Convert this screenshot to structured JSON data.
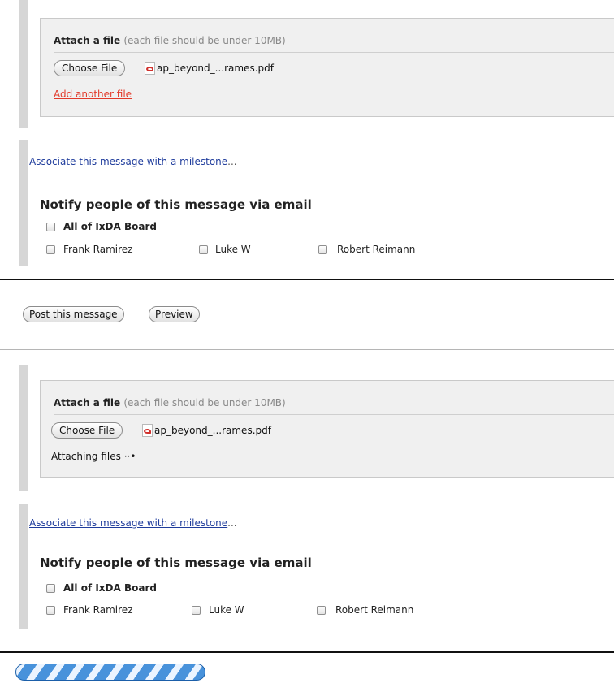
{
  "panels": [
    {
      "attach_title": "Attach a file",
      "attach_note": "(each file should be under 10MB)",
      "choose_file_label": "Choose File",
      "file_name": "ap_beyond_...rames.pdf",
      "add_another_label": "Add another file",
      "milestone_link": "Associate this message with a milestone",
      "milestone_ellipsis": "...",
      "notify_title": "Notify people of this message via email",
      "recipients": [
        "All of IxDA Board",
        "Frank Ramirez",
        "Luke W",
        "Robert Reimann"
      ]
    },
    {
      "attach_title": "Attach a file",
      "attach_note": "(each file should be under 10MB)",
      "choose_file_label": "Choose File",
      "file_name": "ap_beyond_...rames.pdf",
      "attaching_label": "Attaching files",
      "attaching_dots": "··•",
      "milestone_link": "Associate this message with a milestone",
      "milestone_ellipsis": "...",
      "notify_title": "Notify people of this message via email",
      "recipients": [
        "All of IxDA Board",
        "Frank Ramirez",
        "Luke W",
        "Robert Reimann"
      ]
    }
  ],
  "actions": {
    "post_label": "Post this message",
    "preview_label": "Preview"
  },
  "upload_progress": {
    "state": "indeterminate",
    "color": "#2f83d6"
  }
}
